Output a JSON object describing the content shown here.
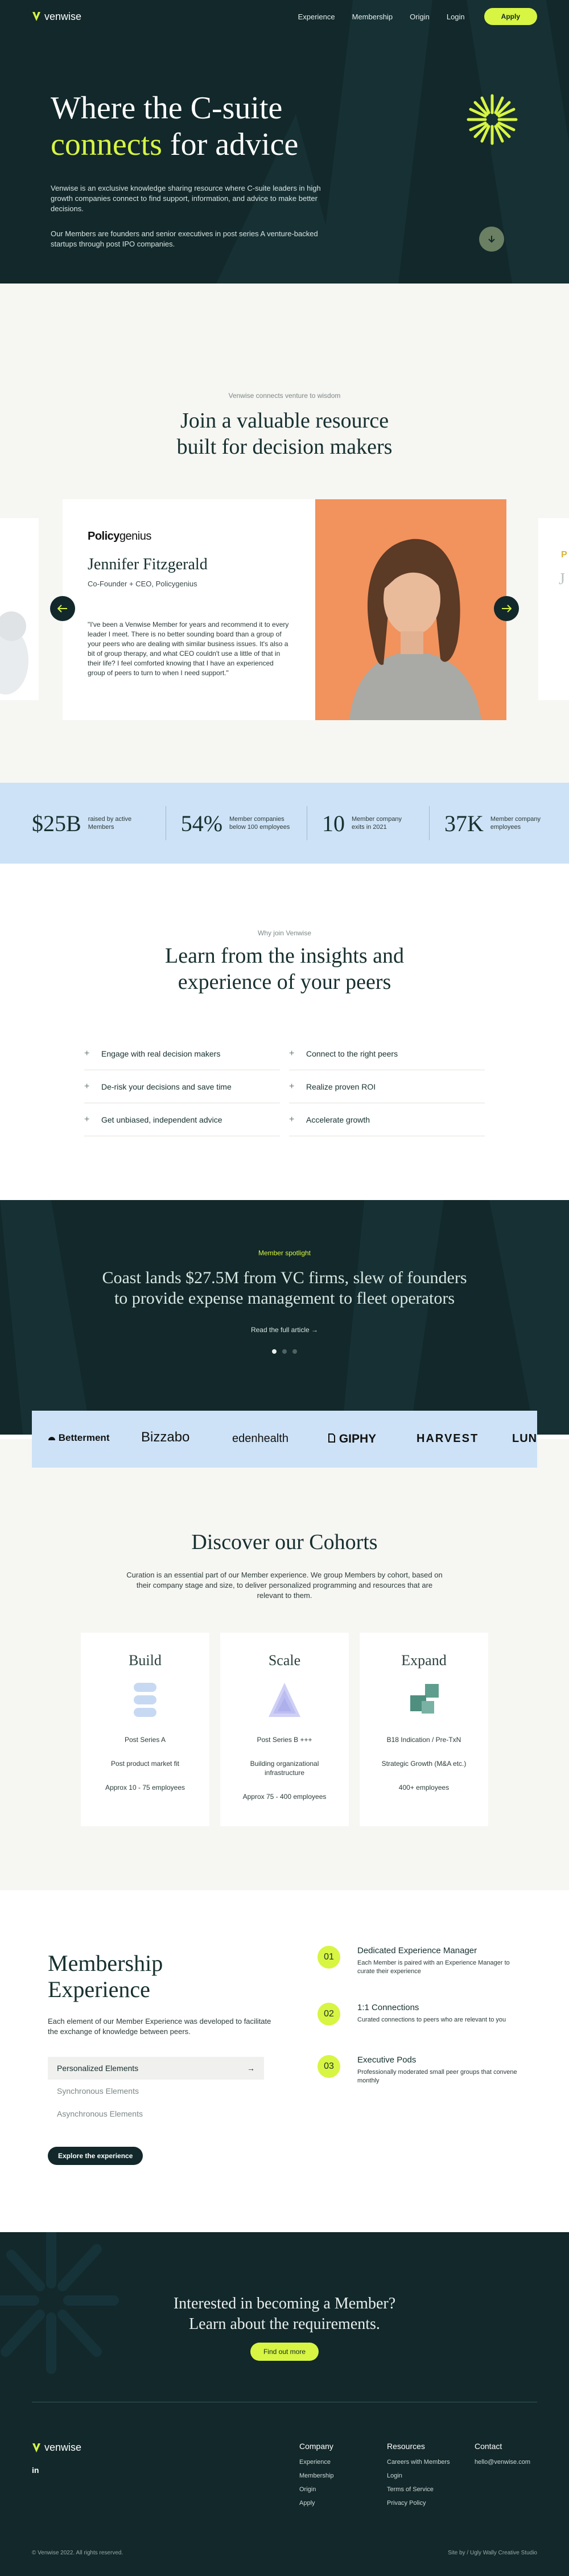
{
  "brand": {
    "name": "venwise",
    "accent": "#d7f542",
    "dark": "#12282a",
    "light_blue": "#cde2f6"
  },
  "nav": {
    "links": [
      "Experience",
      "Membership",
      "Origin",
      "Login"
    ],
    "apply_label": "Apply"
  },
  "hero": {
    "title_line1": "Where the C-suite",
    "title_accent": "connects",
    "title_rest": "for advice",
    "p1": "Venwise is an exclusive knowledge sharing resource where C-suite leaders in high growth companies connect to find support, information, and advice to make better decisions.",
    "p2": "Our Members are founders and senior executives in post series A venture-backed startups through post IPO companies.",
    "down_icon": "arrow-down-icon"
  },
  "testimonials": {
    "eyebrow": "Venwise connects venture to wisdom",
    "title_line1": "Join a valuable resource",
    "title_line2": "built for decision makers",
    "card": {
      "logo_bold": "Policy",
      "logo_light": "genius",
      "name": "Jennifer Fitzgerald",
      "role": "Co-Founder + CEO, Policygenius",
      "quote": "\"I've been a Venwise Member for years and recommend it to every leader I meet. There is no better sounding board than a group of your peers who are dealing with similar business issues. It's also a bit of group therapy, and what CEO couldn't use a little of that in their life? I feel comforted knowing that I have an experienced group of peers to turn to when I need support.\""
    },
    "next_card_logo": "P",
    "next_card_initial": "J"
  },
  "stats": [
    {
      "value": "$25B",
      "label": "raised by active Members"
    },
    {
      "value": "54%",
      "label": "Member companies below 100 employees"
    },
    {
      "value": "10",
      "label": "Member company exits in 2021"
    },
    {
      "value": "37K",
      "label": "Member company employees"
    }
  ],
  "why": {
    "eyebrow": "Why join Venwise",
    "title_line1": "Learn from the insights and",
    "title_line2": "experience of your peers",
    "benefits": [
      "Engage with real decision makers",
      "Connect to the right peers",
      "De-risk your decisions and save time",
      "Realize proven ROI",
      "Get unbiased, independent advice",
      "Accelerate growth"
    ]
  },
  "spotlight": {
    "eyebrow": "Member spotlight",
    "title_line1": "Coast lands $27.5M from VC firms, slew of founders",
    "title_line2": "to provide expense management to fleet operators",
    "link": "Read the full article →",
    "dots": 3,
    "active_dot": 0
  },
  "logos": [
    "Betterment",
    "Bizzabo",
    "edenhealth",
    "GIPHY",
    "HARVEST",
    "LUNC"
  ],
  "cohorts": {
    "title": "Discover our Cohorts",
    "desc": "Curation is an essential part of our Member experience.  We group Members by cohort, based on their company stage and size, to deliver personalized programming and resources that are relevant to them.",
    "items": [
      {
        "name": "Build",
        "icon": "stacked-pills-icon",
        "lines": [
          "Post Series A",
          "Post product market fit",
          "Approx 10 - 75 employees"
        ]
      },
      {
        "name": "Scale",
        "icon": "stacked-triangle-icon",
        "lines": [
          "Post Series B +++",
          "Building organizational infrastructure",
          "Approx 75 - 400 employees"
        ]
      },
      {
        "name": "Expand",
        "icon": "stacked-squares-icon",
        "lines": [
          "B18 Indication / Pre-TxN",
          "Strategic Growth (M&A etc.)",
          "400+ employees"
        ]
      }
    ]
  },
  "membership": {
    "title_line1": "Membership",
    "title_line2": "Experience",
    "desc": "Each element of our Member Experience was developed to facilitate the exchange of knowledge between peers.",
    "tabs": [
      "Personalized Elements",
      "Synchronous Elements",
      "Asynchronous Elements"
    ],
    "tab_arrow": "→",
    "cta": "Explore the experience",
    "features": [
      {
        "num": "01",
        "title": "Dedicated Experience Manager",
        "desc": "Each Member is paired with an Experience Manager to curate their experience"
      },
      {
        "num": "02",
        "title": "1:1 Connections",
        "desc": "Curated connections to peers who are relevant to you"
      },
      {
        "num": "03",
        "title": "Executive Pods",
        "desc": "Professionally moderated small peer groups that convene monthly"
      }
    ]
  },
  "footer": {
    "cta_line1": "Interested in becoming a Member?",
    "cta_line2": "Learn about the requirements.",
    "cta_button": "Find out more",
    "linkedin": "in",
    "columns": [
      {
        "title": "Company",
        "links": [
          "Experience",
          "Membership",
          "Origin",
          "Apply"
        ]
      },
      {
        "title": "Resources",
        "links": [
          "Careers with Members",
          "Login",
          "Terms of Service",
          "Privacy Policy"
        ]
      },
      {
        "title": "Contact",
        "links": [
          "hello@venwise.com"
        ]
      }
    ],
    "copyright": "© Venwise 2022. All rights reserved.",
    "credit": "Site by / Ugly Wally Creative Studio"
  }
}
